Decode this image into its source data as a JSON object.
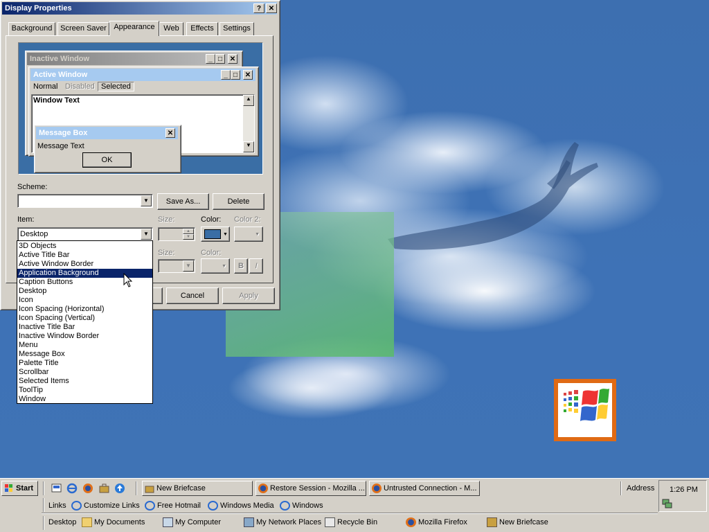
{
  "dialog": {
    "title": "Display Properties",
    "help_btn": "?",
    "close_btn": "✕",
    "tabs": [
      "Background",
      "Screen Saver",
      "Appearance",
      "Web",
      "Effects",
      "Settings"
    ],
    "active_tab": "Appearance",
    "preview": {
      "inactive_title": "Inactive Window",
      "active_title": "Active Window",
      "menu": [
        "Normal",
        "Disabled",
        "Selected"
      ],
      "window_text": "Window Text",
      "msgbox_title": "Message Box",
      "msgbox_text": "Message Text",
      "msgbox_ok": "OK"
    },
    "scheme_label": "Scheme:",
    "scheme_value": "",
    "save_as": "Save As...",
    "delete": "Delete",
    "item_label": "Item:",
    "item_value": "Desktop",
    "size_label": "Size:",
    "color_label": "Color:",
    "color2_label": "Color 2:",
    "font_size_label": "Size:",
    "font_color_label": "Color:",
    "bold": "B",
    "italic": "I",
    "cancel": "Cancel",
    "apply": "Apply",
    "color_value": "#3a6ea5",
    "item_options": [
      "3D Objects",
      "Active Title Bar",
      "Active Window Border",
      "Application Background",
      "Caption Buttons",
      "Desktop",
      "Icon",
      "Icon Spacing (Horizontal)",
      "Icon Spacing (Vertical)",
      "Inactive Title Bar",
      "Inactive Window Border",
      "Menu",
      "Message Box",
      "Palette Title",
      "Scrollbar",
      "Selected Items",
      "ToolTip",
      "Window"
    ],
    "highlighted_option": "Application Background"
  },
  "taskbar": {
    "start": "Start",
    "tasks": [
      "New Briefcase",
      "Restore Session - Mozilla ...",
      "Untrusted Connection - M..."
    ],
    "address_label": "Address",
    "clock": "1:26 PM",
    "links_label": "Links",
    "links": [
      "Customize Links",
      "Free Hotmail",
      "Windows Media",
      "Windows"
    ],
    "desktop_label": "Desktop",
    "desktop_items": [
      "My Documents",
      "My Computer",
      "My Network Places",
      "Recycle Bin",
      "Mozilla Firefox",
      "New Briefcase"
    ]
  },
  "colors": {
    "desktop": "#3a6ea5",
    "active_title": "#0a246a",
    "face": "#d4d0c8"
  },
  "icons": {
    "windows_logo": "windows-flag-icon"
  }
}
